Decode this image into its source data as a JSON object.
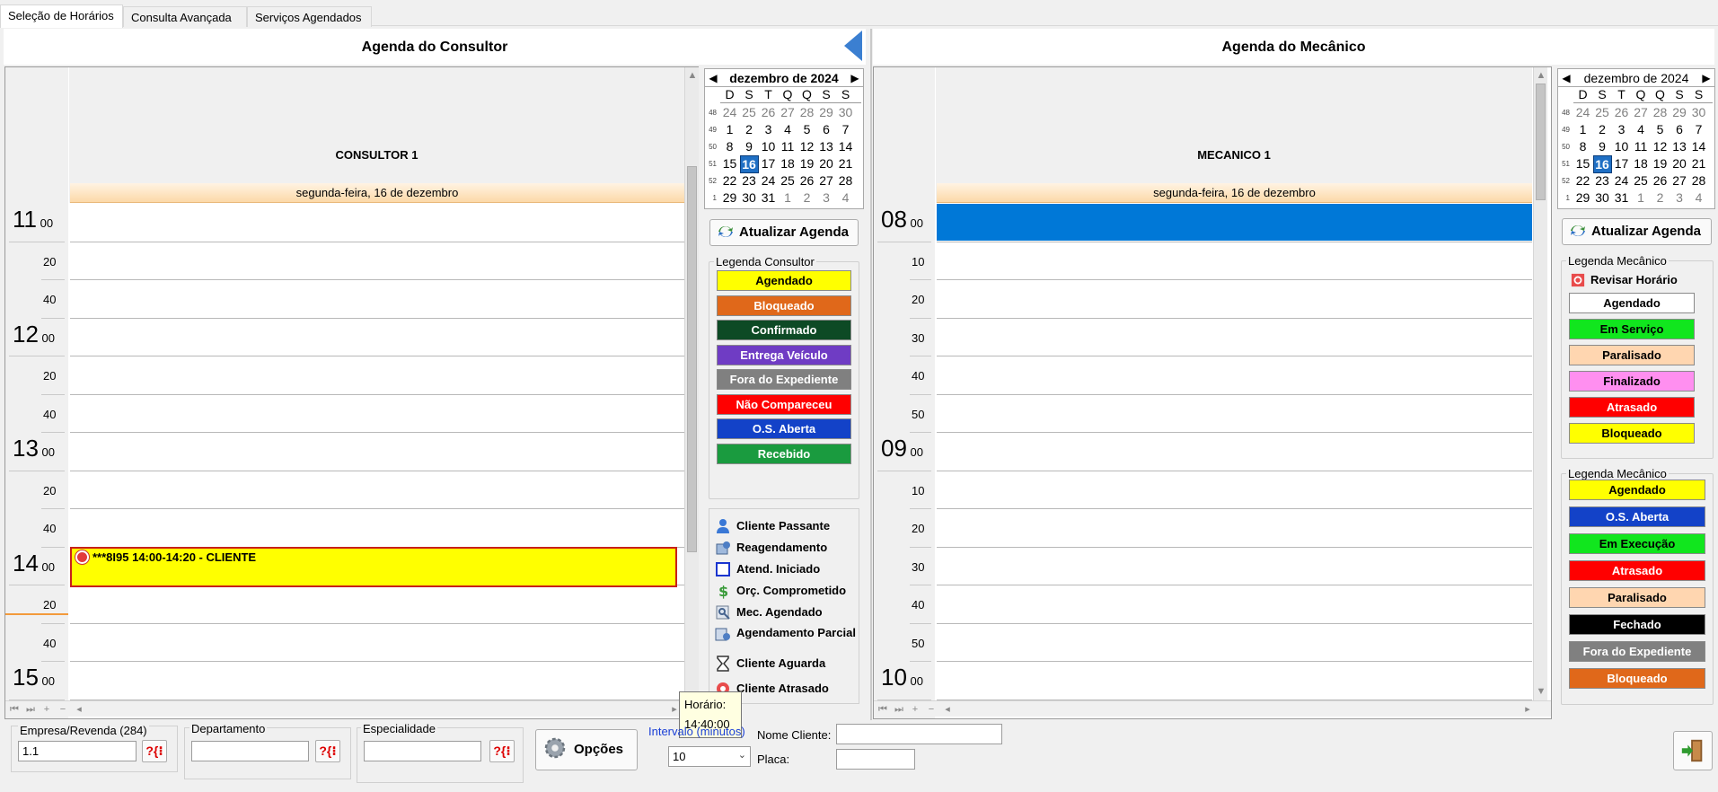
{
  "tabs": [
    "Seleção de Horários",
    "Consulta Avançada",
    "Serviços Agendados"
  ],
  "consultor": {
    "title": "Agenda do Consultor",
    "resource": "CONSULTOR 1",
    "date_label": "segunda-feira, 16 de dezembro",
    "hours": [
      {
        "h": "11",
        "m": "00"
      },
      {
        "h": "",
        "m": "20"
      },
      {
        "h": "",
        "m": "40"
      },
      {
        "h": "12",
        "m": "00"
      },
      {
        "h": "",
        "m": "20"
      },
      {
        "h": "",
        "m": "40"
      },
      {
        "h": "13",
        "m": "00"
      },
      {
        "h": "",
        "m": "20"
      },
      {
        "h": "",
        "m": "40"
      },
      {
        "h": "14",
        "m": "00"
      },
      {
        "h": "",
        "m": "20"
      },
      {
        "h": "",
        "m": "40"
      },
      {
        "h": "15",
        "m": "00"
      }
    ],
    "appointment": "***8I95 14:00-14:20 - CLIENTE"
  },
  "mecanico": {
    "title": "Agenda do Mecânico",
    "resource": "MECANICO 1",
    "date_label": "segunda-feira, 16 de dezembro",
    "hours": [
      {
        "h": "08",
        "m": "00"
      },
      {
        "h": "",
        "m": "10"
      },
      {
        "h": "",
        "m": "20"
      },
      {
        "h": "",
        "m": "30"
      },
      {
        "h": "",
        "m": "40"
      },
      {
        "h": "",
        "m": "50"
      },
      {
        "h": "09",
        "m": "00"
      },
      {
        "h": "",
        "m": "10"
      },
      {
        "h": "",
        "m": "20"
      },
      {
        "h": "",
        "m": "30"
      },
      {
        "h": "",
        "m": "40"
      },
      {
        "h": "",
        "m": "50"
      },
      {
        "h": "10",
        "m": "00"
      }
    ]
  },
  "calendar": {
    "month_label": "dezembro de 2024",
    "weekdays": [
      "D",
      "S",
      "T",
      "Q",
      "Q",
      "S",
      "S"
    ],
    "weeks": [
      {
        "wk": "48",
        "days": [
          "24",
          "25",
          "26",
          "27",
          "28",
          "29",
          "30"
        ],
        "dim": [
          true,
          true,
          true,
          true,
          true,
          true,
          true
        ]
      },
      {
        "wk": "49",
        "days": [
          "1",
          "2",
          "3",
          "4",
          "5",
          "6",
          "7"
        ],
        "dim": [
          false,
          false,
          false,
          false,
          false,
          false,
          false
        ]
      },
      {
        "wk": "50",
        "days": [
          "8",
          "9",
          "10",
          "11",
          "12",
          "13",
          "14"
        ],
        "dim": [
          false,
          false,
          false,
          false,
          false,
          false,
          false
        ]
      },
      {
        "wk": "51",
        "days": [
          "15",
          "16",
          "17",
          "18",
          "19",
          "20",
          "21"
        ],
        "dim": [
          false,
          false,
          false,
          false,
          false,
          false,
          false
        ]
      },
      {
        "wk": "52",
        "days": [
          "22",
          "23",
          "24",
          "25",
          "26",
          "27",
          "28"
        ],
        "dim": [
          false,
          false,
          false,
          false,
          false,
          false,
          false
        ]
      },
      {
        "wk": "1",
        "days": [
          "29",
          "30",
          "31",
          "1",
          "2",
          "3",
          "4"
        ],
        "dim": [
          false,
          false,
          false,
          true,
          true,
          true,
          true
        ]
      }
    ],
    "today": "16"
  },
  "consultor_panel": {
    "refresh_label": "Atualizar Agenda",
    "legend_title": "Legenda Consultor",
    "legend": [
      {
        "label": "Agendado",
        "bg": "#ffff00",
        "fg": "#000000"
      },
      {
        "label": "Bloqueado",
        "bg": "#e0681a",
        "fg": "#ffffff"
      },
      {
        "label": "Confirmado",
        "bg": "#0d4a25",
        "fg": "#ffffff"
      },
      {
        "label": "Entrega Veículo",
        "bg": "#6f3cc4",
        "fg": "#ffffff"
      },
      {
        "label": "Fora do Expediente",
        "bg": "#808080",
        "fg": "#ffffff"
      },
      {
        "label": "Não Compareceu",
        "bg": "#ff0000",
        "fg": "#ffffff"
      },
      {
        "label": "O.S. Aberta",
        "bg": "#1342c8",
        "fg": "#ffffff"
      },
      {
        "label": "Recebido",
        "bg": "#1a9b3f",
        "fg": "#ffffff"
      }
    ],
    "icon_legend": [
      {
        "label": "Cliente Passante",
        "icon": "person-icon"
      },
      {
        "label": "Reagendamento",
        "icon": "reschedule-icon"
      },
      {
        "label": "Atend. Iniciado",
        "icon": "square-outline-icon"
      },
      {
        "label": "Orç. Comprometido",
        "icon": "dollar-icon"
      },
      {
        "label": "Mec. Agendado",
        "icon": "mechanic-icon"
      },
      {
        "label": "Agendamento Parcial",
        "icon": "partial-schedule-icon"
      },
      {
        "label": "Cliente Aguarda",
        "icon": "hourglass-icon"
      },
      {
        "label": "Cliente Atrasado",
        "icon": "late-client-icon"
      }
    ]
  },
  "mecanico_panel": {
    "refresh_label": "Atualizar Agenda",
    "legend1_title": "Legenda Mecânico",
    "revisar_label": "Revisar Horário",
    "legend1": [
      {
        "label": "Agendado",
        "bg": "#ffffff",
        "fg": "#000000"
      },
      {
        "label": "Em Serviço",
        "bg": "#11e61e",
        "fg": "#000000"
      },
      {
        "label": "Paralisado",
        "bg": "#ffd6b0",
        "fg": "#000000"
      },
      {
        "label": "Finalizado",
        "bg": "#ff8ff0",
        "fg": "#000000"
      },
      {
        "label": "Atrasado",
        "bg": "#ff0000",
        "fg": "#ffffff"
      },
      {
        "label": "Bloqueado",
        "bg": "#ffff00",
        "fg": "#000000"
      }
    ],
    "legend2_title": "Legenda Mecânico",
    "legend2": [
      {
        "label": "Agendado",
        "bg": "#ffff00",
        "fg": "#000000"
      },
      {
        "label": "O.S. Aberta",
        "bg": "#1342c8",
        "fg": "#ffffff"
      },
      {
        "label": "Em Execução",
        "bg": "#11e61e",
        "fg": "#000000"
      },
      {
        "label": "Atrasado",
        "bg": "#ff0000",
        "fg": "#ffffff"
      },
      {
        "label": "Paralisado",
        "bg": "#ffd6b0",
        "fg": "#000000"
      },
      {
        "label": "Fechado",
        "bg": "#000000",
        "fg": "#ffffff"
      },
      {
        "label": "Fora do Expediente",
        "bg": "#808080",
        "fg": "#ffffff"
      },
      {
        "label": "Bloqueado",
        "bg": "#e0681a",
        "fg": "#ffffff"
      }
    ]
  },
  "tooltip": {
    "line1": "Horário:",
    "line2": "14:40:00"
  },
  "bottom": {
    "empresa_label": "Empresa/Revenda (284)",
    "empresa_value": "1.1",
    "departamento_label": "Departamento",
    "departamento_value": "",
    "especialidade_label": "Especialidade",
    "especialidade_value": "",
    "lookup_label": "?{⁝",
    "opcoes_label": "Opções",
    "intervalo_label": "Intervalo (minutos)",
    "intervalo_value": "10",
    "nome_cliente_label": "Nome Cliente:",
    "nome_cliente_value": "",
    "placa_label": "Placa:",
    "placa_value": ""
  },
  "colors": {
    "selection_blue": "#0078d7",
    "today_blue": "#1f6fc4",
    "nav_arrow": "#3b7fd1"
  }
}
